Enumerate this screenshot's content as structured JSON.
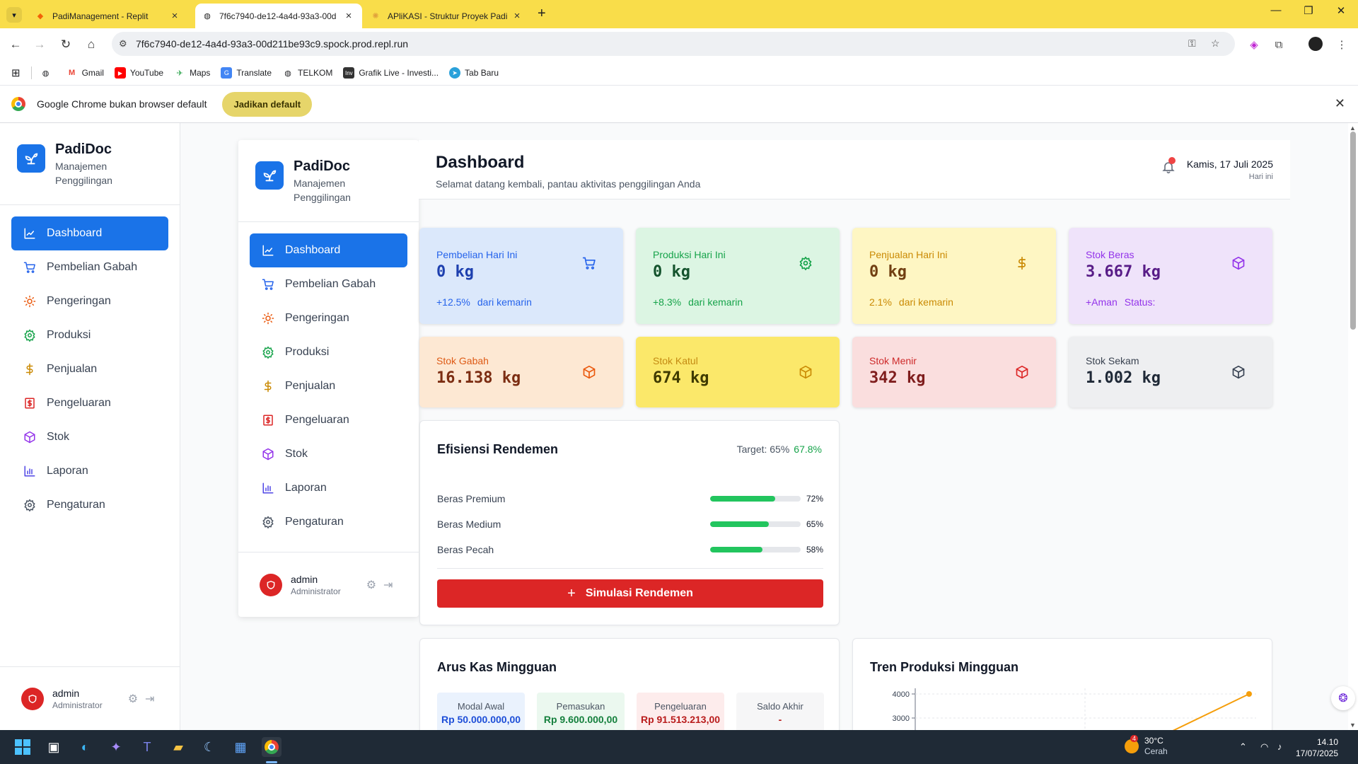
{
  "browser": {
    "tabs": [
      {
        "title": "PadiManagement - Replit",
        "active": false
      },
      {
        "title": "7f6c7940-de12-4a4d-93a3-00d",
        "active": true
      },
      {
        "title": "APliKASI - Struktur Proyek Padi",
        "active": false
      }
    ],
    "url": "7f6c7940-de12-4a4d-93a3-00d211be93c9.spock.prod.repl.run",
    "bookmarks": [
      "Gmail",
      "YouTube",
      "Maps",
      "Translate",
      "TELKOM",
      "Grafik Live - Investi...",
      "Tab Baru"
    ],
    "infobar": {
      "message": "Google Chrome bukan browser default",
      "button": "Jadikan default"
    }
  },
  "app": {
    "brand": {
      "title": "PadiDoc",
      "subtitle": "Manajemen Penggilingan"
    },
    "nav": [
      {
        "label": "Dashboard",
        "icon": "chart-line-icon",
        "active": true
      },
      {
        "label": "Pembelian Gabah",
        "icon": "cart-icon",
        "active": false
      },
      {
        "label": "Pengeringan",
        "icon": "sun-icon",
        "active": false
      },
      {
        "label": "Produksi",
        "icon": "gear-icon",
        "active": false
      },
      {
        "label": "Penjualan",
        "icon": "dollar-icon",
        "active": false
      },
      {
        "label": "Pengeluaran",
        "icon": "receipt-icon",
        "active": false
      },
      {
        "label": "Stok",
        "icon": "box-icon",
        "active": false
      },
      {
        "label": "Laporan",
        "icon": "bar-chart-icon",
        "active": false
      },
      {
        "label": "Pengaturan",
        "icon": "settings-icon",
        "active": false
      }
    ],
    "user": {
      "name": "admin",
      "role": "Administrator"
    },
    "header": {
      "title": "Dashboard",
      "subtitle": "Selamat datang kembali, pantau aktivitas penggilingan Anda",
      "date": "Kamis, 17 Juli 2025",
      "date_sub": "Hari ini"
    },
    "stats": [
      {
        "label": "Pembelian Hari Ini",
        "value": "0 kg",
        "change": "+12.5%",
        "note": "dari kemarin",
        "icon": "cart-icon",
        "bg": "#dbe8fb",
        "fg": "#1e40af",
        "accent": "#2563eb"
      },
      {
        "label": "Produksi Hari Ini",
        "value": "0 kg",
        "change": "+8.3%",
        "note": "dari kemarin",
        "icon": "gear-icon",
        "bg": "#dcf5e3",
        "fg": "#14532d",
        "accent": "#16a34a"
      },
      {
        "label": "Penjualan Hari Ini",
        "value": "0 kg",
        "change": "2.1%",
        "note": "dari kemarin",
        "icon": "dollar-icon",
        "bg": "#fef6c3",
        "fg": "#713f12",
        "accent": "#ca8a04"
      },
      {
        "label": "Stok Beras",
        "value": "3.667 kg",
        "change": "+Aman",
        "note": "Status:",
        "icon": "box-icon",
        "bg": "#efe3fa",
        "fg": "#581c87",
        "accent": "#9333ea"
      }
    ],
    "stocks": [
      {
        "label": "Stok Gabah",
        "value": "16.138 kg",
        "icon": "box-icon",
        "bg": "#fde8d3",
        "fg": "#7c2d12",
        "accent": "#ea580c"
      },
      {
        "label": "Stok Katul",
        "value": "674 kg",
        "icon": "box-icon",
        "bg": "#fbe86a",
        "fg": "#3f3a00",
        "accent": "#ca8a04"
      },
      {
        "label": "Stok Menir",
        "value": "342 kg",
        "icon": "box-icon",
        "bg": "#fadede",
        "fg": "#7f1d1d",
        "accent": "#dc2626"
      },
      {
        "label": "Stok Sekam",
        "value": "1.002 kg",
        "icon": "box-icon",
        "bg": "#eeeff1",
        "fg": "#1f2937",
        "accent": "#374151"
      }
    ],
    "rendemen": {
      "title": "Efisiensi Rendemen",
      "target_label": "Target: 65%",
      "target_value": "67.8%",
      "rows": [
        {
          "label": "Beras Premium",
          "pct": 72,
          "pct_label": "72%"
        },
        {
          "label": "Beras Medium",
          "pct": 65,
          "pct_label": "65%"
        },
        {
          "label": "Beras Pecah",
          "pct": 58,
          "pct_label": "58%"
        }
      ],
      "button": "Simulasi Rendemen"
    },
    "kas": {
      "title": "Arus Kas Mingguan",
      "items": [
        {
          "label": "Modal Awal",
          "value": "Rp 50.000.000,00",
          "bg": "#eaf2fd",
          "fg": "#1d4ed8"
        },
        {
          "label": "Pemasukan",
          "value": "Rp 9.600.000,00",
          "bg": "#ebf8ef",
          "fg": "#15803d"
        },
        {
          "label": "Pengeluaran",
          "value": "Rp 91.513.213,00",
          "bg": "#fdecec",
          "fg": "#b91c1c"
        },
        {
          "label": "Saldo Akhir",
          "value": "-",
          "bg": "#f6f6f7",
          "fg": "#b91c1c"
        }
      ]
    },
    "tren": {
      "title": "Tren Produksi Mingguan"
    }
  },
  "chart_data": {
    "type": "line",
    "title": "Tren Produksi Mingguan",
    "yticks": [
      3000,
      4000
    ],
    "series": [
      {
        "values": [
          3667
        ]
      }
    ]
  },
  "taskbar": {
    "temp": "30°C",
    "weather": "Cerah",
    "weather_badge": "4",
    "time": "14.10",
    "date": "17/07/2025"
  }
}
